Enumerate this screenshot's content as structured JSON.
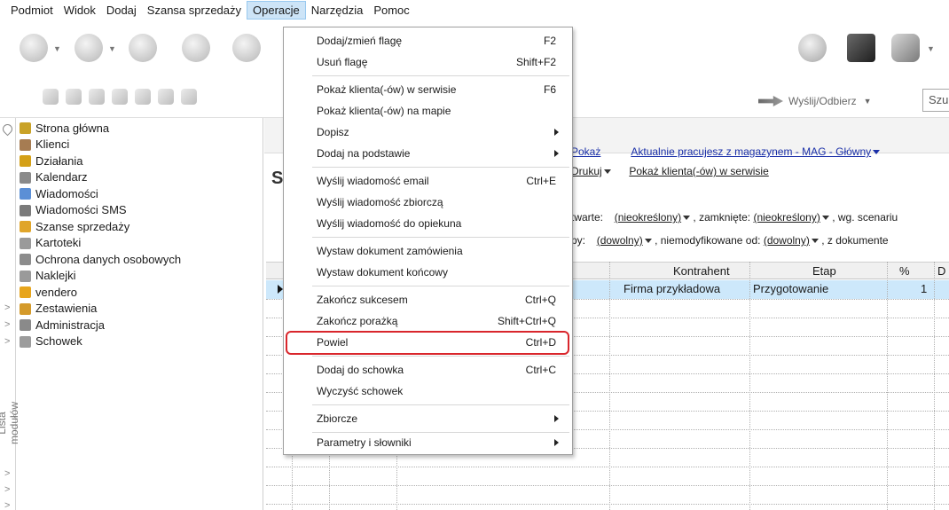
{
  "menubar": {
    "items": [
      "Podmiot",
      "Widok",
      "Dodaj",
      "Szansa sprzedaży",
      "Operacje",
      "Narzędzia",
      "Pomoc"
    ],
    "open_item": "Operacje"
  },
  "toolbar": {
    "send_receive_label": "Wyślij/Odbierz",
    "search_placeholder": "Szu"
  },
  "sidebar": {
    "vertical_label": "Lista modułów",
    "chevron_glyph": ">",
    "items": [
      {
        "label": "Strona główna",
        "icon": "home-icon",
        "color": "#c9a227"
      },
      {
        "label": "Klienci",
        "icon": "clients-icon",
        "color": "#a67c52"
      },
      {
        "label": "Działania",
        "icon": "pencil-icon",
        "color": "#d4a017"
      },
      {
        "label": "Kalendarz",
        "icon": "calendar-icon",
        "color": "#8a8a8a"
      },
      {
        "label": "Wiadomości",
        "icon": "envelope-icon",
        "color": "#5b8fd6"
      },
      {
        "label": "Wiadomości SMS",
        "icon": "sms-icon",
        "color": "#7a7a7a"
      },
      {
        "label": "Szanse sprzedaży",
        "icon": "coins-icon",
        "color": "#e0a52a"
      },
      {
        "label": "Kartoteki",
        "icon": "cards-icon",
        "color": "#9a9a9a"
      },
      {
        "label": "Ochrona danych osobowych",
        "icon": "shield-icon",
        "color": "#8c8c8c"
      },
      {
        "label": "Naklejki",
        "icon": "sticker-icon",
        "color": "#9a9a9a"
      },
      {
        "label": "vendero",
        "icon": "vendero-icon",
        "color": "#e7a51c"
      },
      {
        "label": "Zestawienia",
        "icon": "report-icon",
        "color": "#d49a2a"
      },
      {
        "label": "Administracja",
        "icon": "admin-icon",
        "color": "#8a8a8a"
      },
      {
        "label": "Schowek",
        "icon": "clipboard-icon",
        "color": "#9c9c9c"
      }
    ]
  },
  "main": {
    "title_letter": "S",
    "links": {
      "pokaz": "Pokaż",
      "magazyn": "Aktualnie pracujesz z magazynem - MAG - Główny",
      "drukuj": "Drukuj",
      "pokaz_klienta": "Pokaż klienta(-ów) w serwisie"
    },
    "filter_row1": {
      "prefix": "twarte:",
      "val1": "(nieokreślony)",
      "mid": ", zamknięte:",
      "val2": "(nieokreślony)",
      "suffix": ", wg. scenariu"
    },
    "filter_row2": {
      "prefix": "py:",
      "val1": "(dowolny)",
      "mid": ", niemodyfikowane od:",
      "val2": "(dowolny)",
      "suffix": ", z dokumente"
    },
    "grid": {
      "columns": [
        "Kontrahent",
        "Etap",
        "%",
        "D"
      ],
      "row": {
        "kontrahent": "Firma przykładowa",
        "etap": "Przygotowanie",
        "percent": "1"
      }
    }
  },
  "dropdown": {
    "items": [
      {
        "label": "Dodaj/zmień flagę",
        "shortcut": "F2"
      },
      {
        "label": "Usuń flagę",
        "shortcut": "Shift+F2"
      },
      {
        "label": "Pokaż klienta(-ów) w serwisie",
        "shortcut": "F6"
      },
      {
        "label": "Pokaż klienta(-ów) na mapie",
        "shortcut": ""
      },
      {
        "label": "Dopisz",
        "shortcut": "",
        "submenu": true
      },
      {
        "label": "Dodaj na podstawie",
        "shortcut": "",
        "submenu": true
      },
      {
        "label": "Wyślij wiadomość email",
        "shortcut": "Ctrl+E"
      },
      {
        "label": "Wyślij wiadomość zbiorczą",
        "shortcut": ""
      },
      {
        "label": "Wyślij wiadomość do opiekuna",
        "shortcut": ""
      },
      {
        "label": "Wystaw dokument zamówienia",
        "shortcut": ""
      },
      {
        "label": "Wystaw dokument końcowy",
        "shortcut": ""
      },
      {
        "label": "Zakończ sukcesem",
        "shortcut": "Ctrl+Q"
      },
      {
        "label": "Zakończ porażką",
        "shortcut": "Shift+Ctrl+Q"
      },
      {
        "label": "Powiel",
        "shortcut": "Ctrl+D",
        "highlighted": true
      },
      {
        "label": "Dodaj do schowka",
        "shortcut": "Ctrl+C"
      },
      {
        "label": "Wyczyść schowek",
        "shortcut": ""
      },
      {
        "label": "Zbiorcze",
        "shortcut": "",
        "submenu": true
      },
      {
        "label": "Parametry i słowniki",
        "shortcut": "",
        "submenu": true
      }
    ],
    "highlight_color": "#d9262c"
  }
}
